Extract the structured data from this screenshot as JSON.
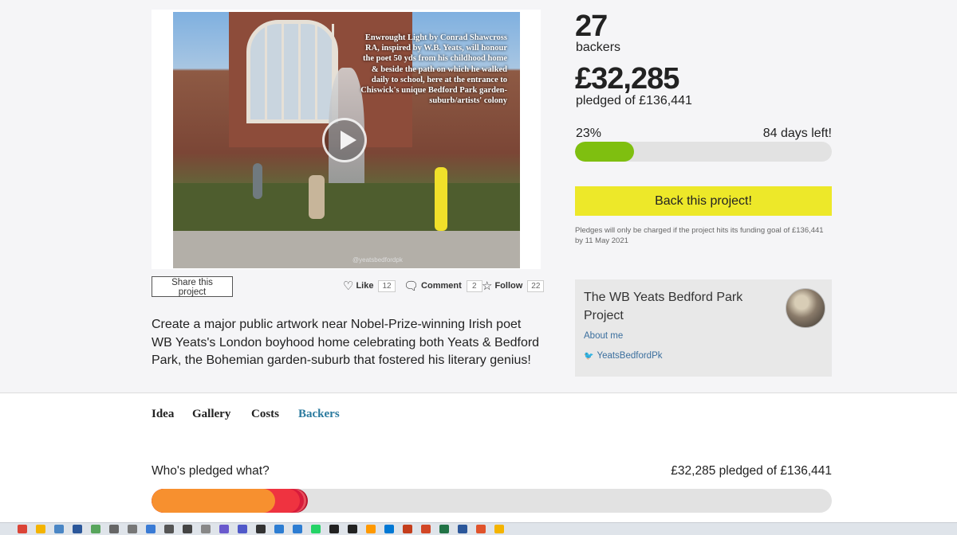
{
  "video": {
    "overlay_text": "Enwrought Light by Conrad Shawcross RA, inspired by W.B. Yeats, will honour the poet 50 yds from his childhood home & beside the path on which he walked daily to school, here at the entrance to Chiswick's unique Bedford Park garden-suburb/artists' colony",
    "credit": "@yeatsbedfordpk"
  },
  "stats": {
    "backers_count": "27",
    "backers_label": "backers",
    "pledged_amount": "£32,285",
    "pledged_label": "pledged of £136,441",
    "percent_label": "23%",
    "percent_value": 23,
    "days_left": "84 days left!"
  },
  "cta": {
    "back_label": "Back this project!",
    "note": "Pledges will only be charged if the project hits its funding goal of £136,441 by 11 May 2021"
  },
  "creator": {
    "name": "The WB Yeats Bedford Park Project",
    "about_label": "About me",
    "twitter_handle": "YeatsBedfordPk"
  },
  "actions": {
    "share_label": "Share this project",
    "like_label": "Like",
    "like_count": "12",
    "comment_label": "Comment",
    "comment_count": "2",
    "follow_label": "Follow",
    "follow_count": "22"
  },
  "description": "Create a major public artwork near Nobel-Prize-winning Irish poet WB Yeats's London boyhood home celebrating both Yeats & Bedford Park, the Bohemian garden-suburb that fostered his literary genius!",
  "tabs": [
    {
      "label": "Idea",
      "active": false
    },
    {
      "label": "Gallery",
      "active": false
    },
    {
      "label": "Costs",
      "active": false
    },
    {
      "label": "Backers",
      "active": true
    }
  ],
  "pledges": {
    "title": "Who's pledged what?",
    "total": "£32,285 pledged of £136,441",
    "segments": [
      {
        "percent": 18.2,
        "color": "#f7902f"
      },
      {
        "percent": 3.6,
        "color": "#ef3340"
      },
      {
        "percent": 0.6,
        "color": "#d81b3b"
      },
      {
        "percent": 0.4,
        "color": "#e8505e"
      },
      {
        "percent": 0.2,
        "color": "#b8162e"
      }
    ]
  },
  "taskbar": {
    "icons": [
      "chrome-icon",
      "chrome-icon",
      "folder-icon",
      "app-icon",
      "app-icon",
      "app-icon",
      "app-icon",
      "app-icon",
      "app-icon",
      "calculator-icon",
      "clock-icon",
      "app-icon",
      "teams-icon",
      "app-icon",
      "app-icon",
      "app-icon",
      "whatsapp-icon",
      "app-icon",
      "app-icon",
      "amazon-icon",
      "app-icon",
      "app-icon",
      "powerpoint-icon",
      "excel-icon",
      "word-icon",
      "app-icon",
      "app-icon"
    ]
  }
}
